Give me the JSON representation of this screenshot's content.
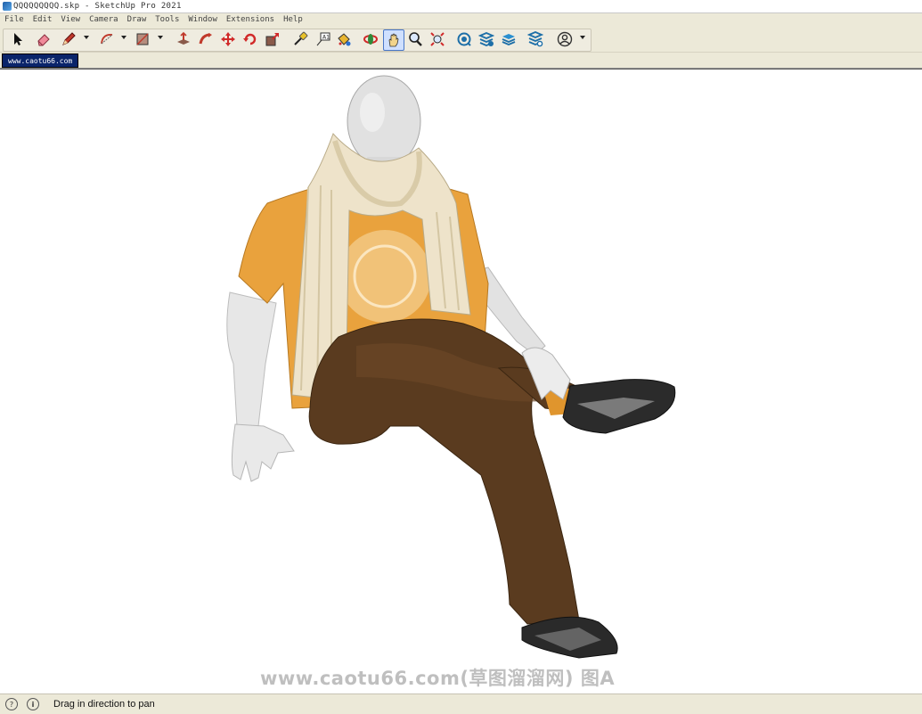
{
  "window": {
    "title": "QQQQQQQQQ.skp - SketchUp Pro 2021"
  },
  "menu": [
    "File",
    "Edit",
    "View",
    "Camera",
    "Draw",
    "Tools",
    "Window",
    "Extensions",
    "Help"
  ],
  "toolbar": {
    "tools": [
      {
        "name": "select-tool",
        "icon": "arrow-cursor-icon"
      },
      {
        "name": "eraser-tool",
        "icon": "eraser-icon"
      },
      {
        "name": "line-tool",
        "icon": "pencil-icon"
      },
      {
        "name": "arc-tool",
        "icon": "arc-icon"
      },
      {
        "name": "rectangle-tool",
        "icon": "rectangle-icon"
      },
      {
        "name": "push-pull-tool",
        "icon": "push-pull-icon"
      },
      {
        "name": "follow-me-tool",
        "icon": "follow-me-icon"
      },
      {
        "name": "move-tool",
        "icon": "move-icon"
      },
      {
        "name": "rotate-tool",
        "icon": "rotate-icon"
      },
      {
        "name": "scale-tool",
        "icon": "scale-icon"
      },
      {
        "name": "tape-measure-tool",
        "icon": "tape-measure-icon"
      },
      {
        "name": "text-tool",
        "icon": "text-icon"
      },
      {
        "name": "paint-bucket-tool",
        "icon": "paint-bucket-icon"
      },
      {
        "name": "orbit-tool",
        "icon": "orbit-icon"
      },
      {
        "name": "pan-tool",
        "icon": "pan-hand-icon",
        "active": true
      },
      {
        "name": "zoom-tool",
        "icon": "magnifier-icon"
      },
      {
        "name": "zoom-extents-tool",
        "icon": "zoom-extents-icon"
      },
      {
        "name": "warehouse-tool",
        "icon": "3d-warehouse-icon"
      },
      {
        "name": "extension-warehouse-tool",
        "icon": "extension-warehouse-icon"
      },
      {
        "name": "layout-tool",
        "icon": "layout-icon"
      },
      {
        "name": "extension-manager-tool",
        "icon": "extension-manager-icon"
      },
      {
        "name": "account-tool",
        "icon": "user-account-icon"
      }
    ],
    "accent": "#4a78c8"
  },
  "scene_tab": {
    "label": "www.caotu66.com"
  },
  "viewport": {
    "watermark": "www.caotu66.com(草图溜溜网) 图A"
  },
  "status": {
    "message": "Drag in direction to pan"
  }
}
